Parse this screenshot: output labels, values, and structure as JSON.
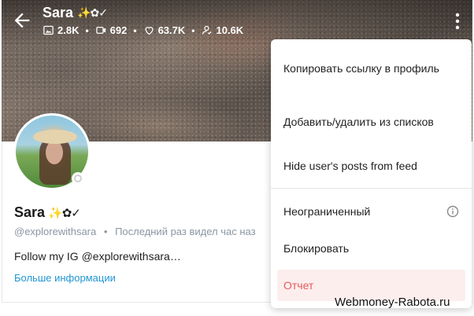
{
  "header": {
    "name": "Sara",
    "badges": "✨✿✓",
    "stats": [
      {
        "icon": "image-icon",
        "value": "2.8K"
      },
      {
        "icon": "video-icon",
        "value": "692"
      },
      {
        "icon": "heart-icon",
        "value": "63.7K"
      },
      {
        "icon": "fans-icon",
        "value": "10.6K"
      }
    ],
    "stat_separator": "•"
  },
  "profile": {
    "name": "Sara",
    "badges": "✨✿✓",
    "handle": "@explorewithsara",
    "separator": "•",
    "last_seen": "Последний раз видел час наз",
    "bio": "Follow my IG @explorewithsara…",
    "more_info": "Больше информации"
  },
  "menu": {
    "items": [
      {
        "label": "Копировать ссылку в профиль"
      },
      {
        "label": "Добавить/удалить из списков"
      },
      {
        "label": "Hide user's posts from feed"
      },
      {
        "label": "Неограниченный"
      },
      {
        "label": "Блокировать"
      },
      {
        "label": "Отчет"
      }
    ]
  },
  "colors": {
    "link": "#2196d3",
    "danger_text": "#e65a5a",
    "danger_bg": "#fdeeee",
    "muted": "#8a96a3"
  },
  "watermark": "Webmoney-Rabota.ru"
}
